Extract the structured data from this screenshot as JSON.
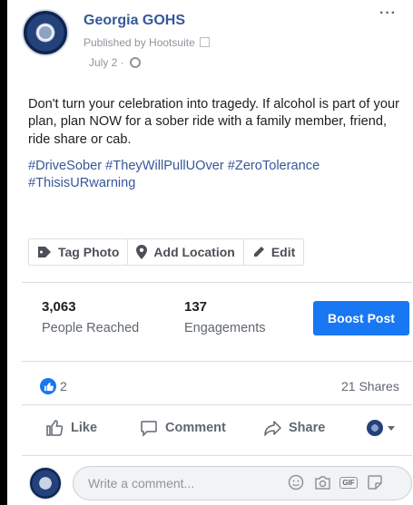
{
  "post": {
    "page_name": "Georgia GOHS",
    "published_by": "Published by Hootsuite",
    "date": "July 2 ·",
    "text": "Don't turn your celebration into tragedy. If alcohol is part of your plan, plan NOW for a sober ride with a family member, friend, ride share or cab.",
    "hashtags": "#DriveSober #TheyWillPullUOver #ZeroTolerance #ThisisURwarning"
  },
  "photo_actions": {
    "tag_photo": "Tag Photo",
    "add_location": "Add Location",
    "edit": "Edit"
  },
  "stats": {
    "reached_value": "3,063",
    "reached_label": "People Reached",
    "engagements_value": "137",
    "engagements_label": "Engagements",
    "boost_label": "Boost Post"
  },
  "reactions": {
    "like_count": "2",
    "shares": "21 Shares"
  },
  "actions": {
    "like": "Like",
    "comment": "Comment",
    "share": "Share"
  },
  "comment_box": {
    "placeholder": "Write a comment..."
  },
  "colors": {
    "brand_blue": "#1877f2",
    "link_blue": "#365899",
    "muted_text": "#606770"
  }
}
